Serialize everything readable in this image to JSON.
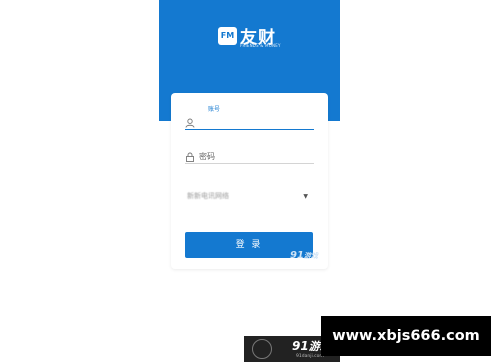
{
  "brand": {
    "badge": "FM",
    "name": "友财",
    "tagline": "FRIENDS & MONEY"
  },
  "login": {
    "account_label": "账号",
    "account_value": "",
    "password_placeholder": "密码",
    "server_select_value": "新新电讯网络",
    "submit_label": "登 录"
  },
  "watermark": {
    "logo_number": "91",
    "logo_text": "游戏",
    "logo_url": "91danji.com"
  },
  "banner": {
    "text": "www.xbjs666.com"
  },
  "colors": {
    "brand_blue": "#1479d0"
  }
}
